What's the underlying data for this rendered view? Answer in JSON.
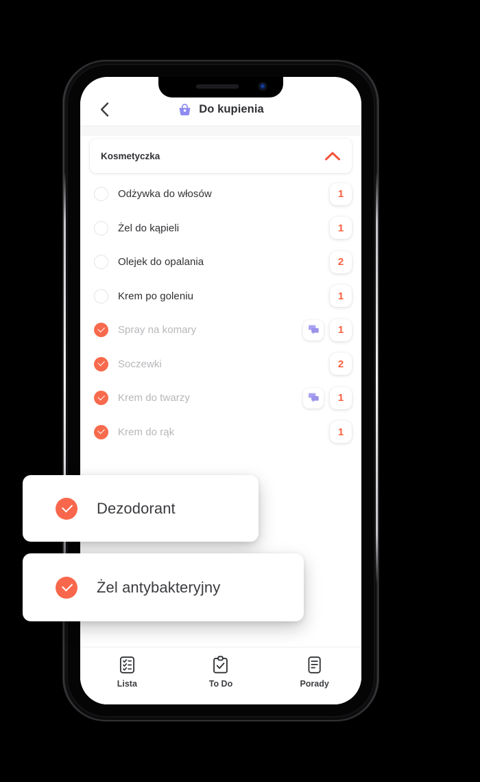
{
  "header": {
    "back_icon": "chevron-left-icon",
    "basket_icon": "shopping-basket-icon",
    "title": "Do kupienia"
  },
  "group": {
    "title": "Kosmetyczka",
    "collapse_icon": "chevron-up-icon",
    "expanded": true
  },
  "colors": {
    "accent_orange": "#F8674C",
    "badge_orange": "#F8603F",
    "comment_purple": "#9A93E8",
    "basket_purple": "#8E8CF0",
    "text_dark": "#2F3033",
    "text_muted": "#B6B7BA",
    "screen_bg": "#FFFFFF"
  },
  "items": [
    {
      "label": "Odżywka do włosów",
      "checked": false,
      "qty": "1",
      "has_comment": false
    },
    {
      "label": "Żel do kąpieli",
      "checked": false,
      "qty": "1",
      "has_comment": false
    },
    {
      "label": "Olejek do opalania",
      "checked": false,
      "qty": "2",
      "has_comment": false
    },
    {
      "label": "Krem po goleniu",
      "checked": false,
      "qty": "1",
      "has_comment": false
    },
    {
      "label": "Spray na komary",
      "checked": true,
      "qty": "1",
      "has_comment": true
    },
    {
      "label": "Soczewki",
      "checked": true,
      "qty": "2",
      "has_comment": false
    },
    {
      "label": "Krem do twarzy",
      "checked": true,
      "qty": "1",
      "has_comment": true
    },
    {
      "label": "Krem do rąk",
      "checked": true,
      "qty": "1",
      "has_comment": false
    }
  ],
  "floating_cards": [
    {
      "label": "Dezodorant",
      "checked": true,
      "check_icon": "check-circle-icon"
    },
    {
      "label": "Żel antybakteryjny",
      "checked": true,
      "check_icon": "check-circle-icon"
    }
  ],
  "bottom_nav": {
    "items": [
      {
        "label": "Lista",
        "icon": "checklist-clipboard-icon",
        "active": false
      },
      {
        "label": "To Do",
        "icon": "clipboard-check-icon",
        "active": false
      },
      {
        "label": "Porady",
        "icon": "document-lines-icon",
        "active": false
      }
    ]
  }
}
